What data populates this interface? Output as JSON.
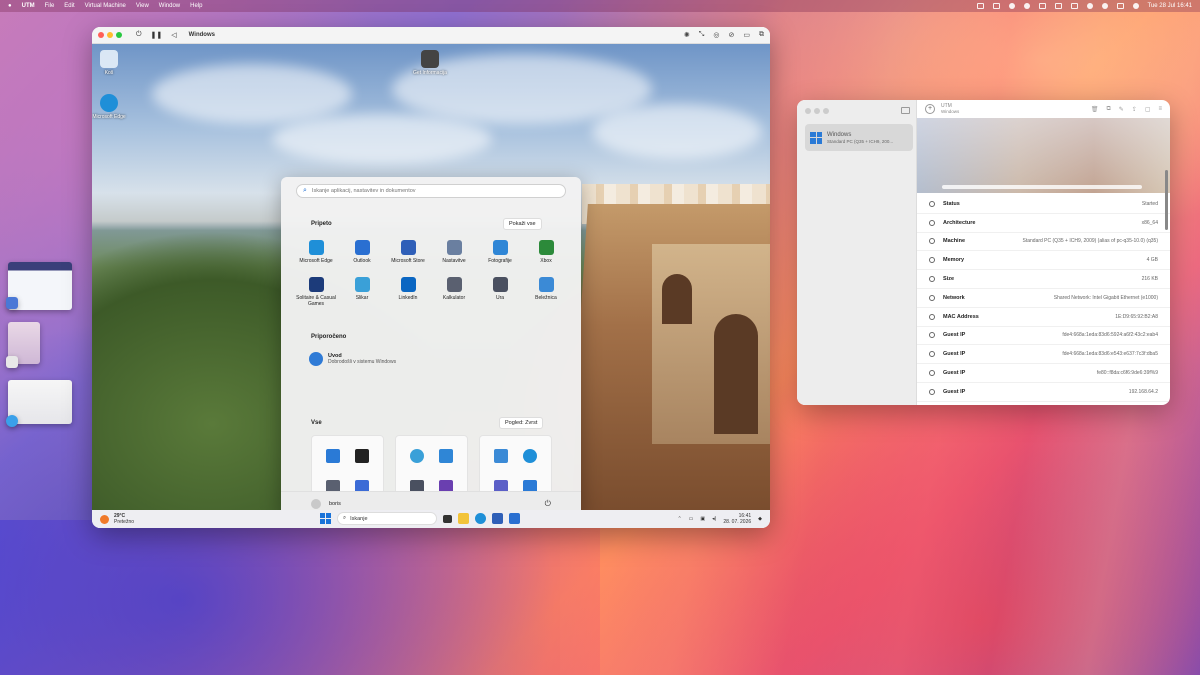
{
  "menubar": {
    "items": [
      "UTM",
      "File",
      "Edit",
      "Virtual Machine",
      "View",
      "Window",
      "Help"
    ],
    "clock": "Tue 28 Jul  16:41"
  },
  "vm_window": {
    "title": "Windows"
  },
  "desktop_icons": [
    "Koš",
    "Microsoft Edge",
    "Get Informacija"
  ],
  "start_menu": {
    "search_placeholder": "Iskanje aplikacij, nastavitev in dokumentov",
    "pinned_title": "Pripeto",
    "pinned_button": "Pokaži vse",
    "pinned": [
      {
        "label": "Microsoft Edge",
        "color": "#1f8fd8"
      },
      {
        "label": "Outlook",
        "color": "#2a6fd1"
      },
      {
        "label": "Microsoft Store",
        "color": "#2f5fb8"
      },
      {
        "label": "Nastavitve",
        "color": "#6a7fa0"
      },
      {
        "label": "Fotografije",
        "color": "#2f86d6"
      },
      {
        "label": "Xbox",
        "color": "#2c8a3a"
      },
      {
        "label": "Solitaire & Casual Games",
        "color": "#1c3b7a"
      },
      {
        "label": "Slikar",
        "color": "#3aa0d8"
      },
      {
        "label": "LinkedIn",
        "color": "#0a66c2"
      },
      {
        "label": "Kalkulator",
        "color": "#5a6070"
      },
      {
        "label": "Ura",
        "color": "#4a5060"
      },
      {
        "label": "Beležnica",
        "color": "#3b8ad6"
      }
    ],
    "recommended_title": "Priporočeno",
    "recommended": {
      "title": "Uvod",
      "subtitle": "Dobrodošli v sistemu Windows"
    },
    "all_title": "Vse",
    "all_button": "Pogled: Zvrst",
    "user": "boris"
  },
  "taskbar": {
    "weather_temp": "29°C",
    "weather_desc": "Pretežno",
    "search": "Iskanje",
    "time": "16:41",
    "date": "28. 07. 2026"
  },
  "utm": {
    "title": "UTM",
    "subtitle": "Windows",
    "vm_name": "Windows",
    "vm_sub": "Standard PC (Q35 + ICH9, 200...",
    "rows": [
      {
        "key": "Status",
        "value": "Started"
      },
      {
        "key": "Architecture",
        "value": "x86_64"
      },
      {
        "key": "Machine",
        "value": "Standard PC (Q35 + ICH9, 2009) (alias of pc-q35-10.0) (q35)"
      },
      {
        "key": "Memory",
        "value": "4 GB"
      },
      {
        "key": "Size",
        "value": "216 KB"
      },
      {
        "key": "Network",
        "value": "Shared Network: Intel Gigabit Ethernet (e1000)"
      },
      {
        "key": "MAC Address",
        "value": "1E:D9:65:92:B2:A8"
      },
      {
        "key": "Guest IP",
        "value": "fde4:668a:1eda:83d6:5924:a6f2:43c2:eab4"
      },
      {
        "key": "Guest IP",
        "value": "fde4:668a:1eda:83d6:e543:e637:7c3f:dba5"
      },
      {
        "key": "Guest IP",
        "value": "fe80::f8da:c6f6:9de6:39f%9"
      },
      {
        "key": "Guest IP",
        "value": "192.168.64.2"
      }
    ]
  }
}
